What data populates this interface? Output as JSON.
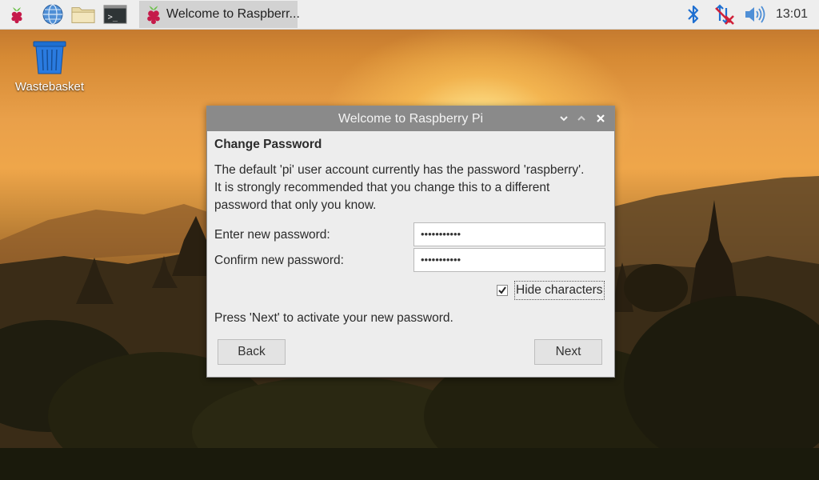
{
  "taskbar": {
    "menu_icon": "raspberry-icon",
    "browser_icon": "globe-icon",
    "files_icon": "folder-icon",
    "terminal_icon": "terminal-icon",
    "active_window_label": "Welcome to Raspberr...",
    "bluetooth_icon": "bluetooth-icon",
    "network_icon": "network-disconnected-icon",
    "volume_icon": "volume-icon",
    "clock": "13:01"
  },
  "desktop": {
    "icons": [
      {
        "label": "Wastebasket",
        "icon": "trash-icon"
      }
    ]
  },
  "dialog": {
    "title": "Welcome to Raspberry Pi",
    "heading": "Change Password",
    "description_lines": [
      "The default 'pi' user account currently has the password 'raspberry'.",
      "It is strongly recommended that you change this to a different",
      "password that only you know."
    ],
    "new_password_label": "Enter new password:",
    "new_password_value": "•••••••••••",
    "confirm_password_label": "Confirm new password:",
    "confirm_password_value": "•••••••••••",
    "hide_characters_label": "Hide characters",
    "hide_characters_checked": true,
    "instruction": "Press 'Next' to activate your new password.",
    "back_label": "Back",
    "next_label": "Next"
  },
  "colors": {
    "titlebar": "#8a8a8a",
    "dialog_bg": "#ededed",
    "taskbar_bg": "#eeeeee",
    "bluetooth": "#1e6fd1",
    "network_x": "#d0213a",
    "raspberry_red": "#c51a4a",
    "raspberry_leaf": "#6cc04a"
  }
}
